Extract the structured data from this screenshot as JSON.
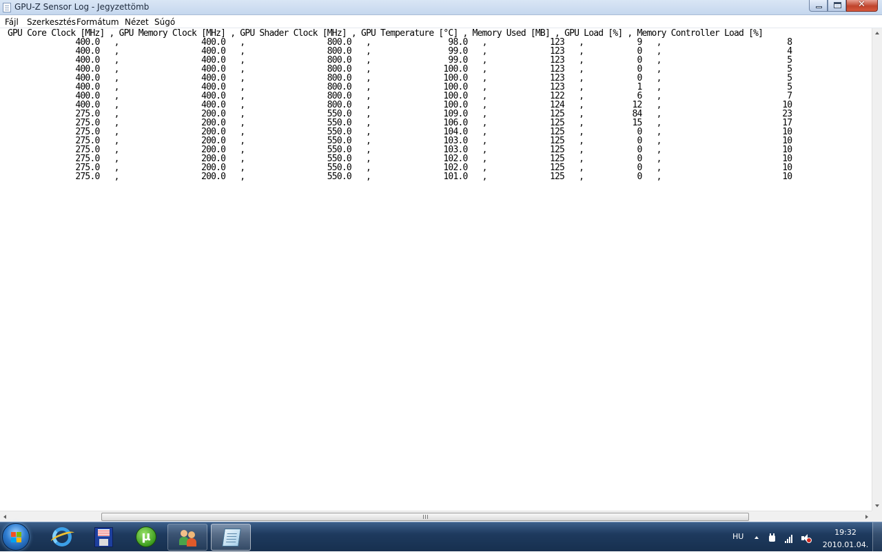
{
  "window": {
    "title": "GPU-Z Sensor Log - Jegyzettömb"
  },
  "menu": [
    "Fájl",
    "Szerkesztés",
    "Formátum",
    "Nézet",
    "Súgó"
  ],
  "log": {
    "columns": [
      {
        "header": "GPU Core Clock [MHz]",
        "width": 21
      },
      {
        "header": "GPU Memory Clock [MHz]",
        "width": 23
      },
      {
        "header": "GPU Shader Clock [MHz]",
        "width": 23
      },
      {
        "header": "GPU Temperature [°C]",
        "width": 21
      },
      {
        "header": "Memory Used [MB]",
        "width": 17
      },
      {
        "header": "GPU Load [%]",
        "width": 13
      },
      {
        "header": "Memory Controller Load [%]",
        "width": 26
      }
    ],
    "rows": [
      [
        "400.0",
        "400.0",
        "800.0",
        "98.0",
        "123",
        "9",
        "8"
      ],
      [
        "400.0",
        "400.0",
        "800.0",
        "99.0",
        "123",
        "0",
        "4"
      ],
      [
        "400.0",
        "400.0",
        "800.0",
        "99.0",
        "123",
        "0",
        "5"
      ],
      [
        "400.0",
        "400.0",
        "800.0",
        "100.0",
        "123",
        "0",
        "5"
      ],
      [
        "400.0",
        "400.0",
        "800.0",
        "100.0",
        "123",
        "0",
        "5"
      ],
      [
        "400.0",
        "400.0",
        "800.0",
        "100.0",
        "123",
        "1",
        "5"
      ],
      [
        "400.0",
        "400.0",
        "800.0",
        "100.0",
        "122",
        "6",
        "7"
      ],
      [
        "400.0",
        "400.0",
        "800.0",
        "100.0",
        "124",
        "12",
        "10"
      ],
      [
        "275.0",
        "200.0",
        "550.0",
        "109.0",
        "125",
        "84",
        "23"
      ],
      [
        "275.0",
        "200.0",
        "550.0",
        "106.0",
        "125",
        "15",
        "17"
      ],
      [
        "275.0",
        "200.0",
        "550.0",
        "104.0",
        "125",
        "0",
        "10"
      ],
      [
        "275.0",
        "200.0",
        "550.0",
        "103.0",
        "125",
        "0",
        "10"
      ],
      [
        "275.0",
        "200.0",
        "550.0",
        "103.0",
        "125",
        "0",
        "10"
      ],
      [
        "275.0",
        "200.0",
        "550.0",
        "102.0",
        "125",
        "0",
        "10"
      ],
      [
        "275.0",
        "200.0",
        "550.0",
        "102.0",
        "125",
        "0",
        "10"
      ],
      [
        "275.0",
        "200.0",
        "550.0",
        "101.0",
        "125",
        "0",
        "10"
      ]
    ]
  },
  "taskbar": {
    "items": [
      "start-orb",
      "internet-explorer",
      "save-floppy",
      "utorrent",
      "messenger",
      "notepad"
    ],
    "tray": {
      "language": "HU",
      "time": "19:32",
      "date": "2010.01.04."
    }
  }
}
